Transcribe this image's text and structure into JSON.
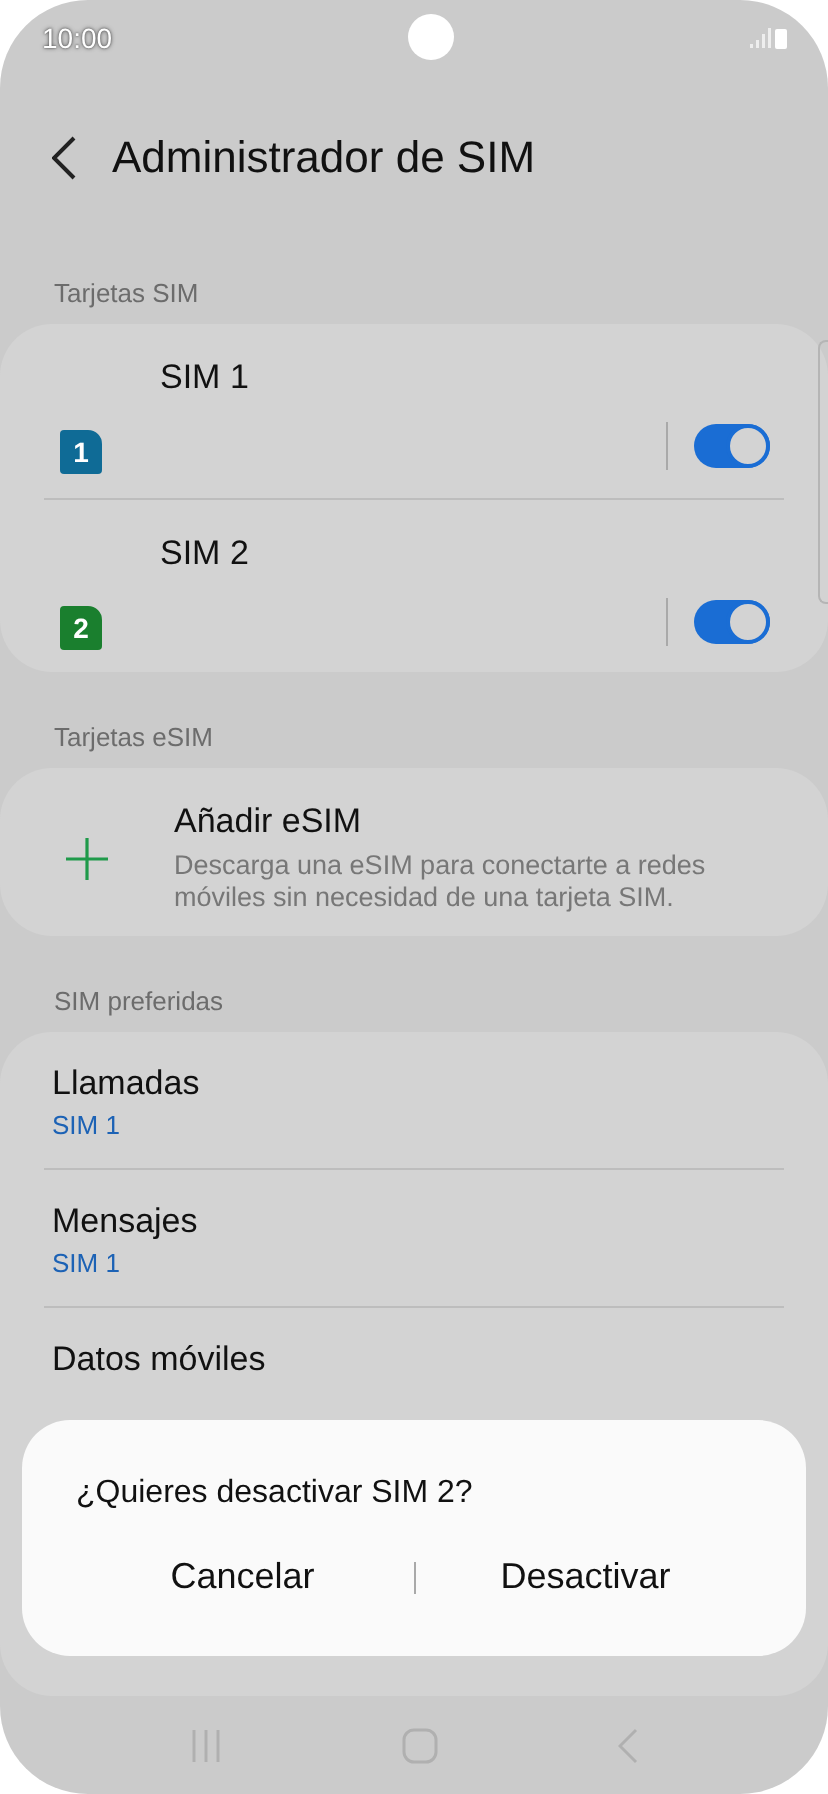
{
  "status_bar": {
    "time": "10:00"
  },
  "header": {
    "title": "Administrador de SIM"
  },
  "sections": [
    {
      "heading": "Tarjetas SIM",
      "items": [
        {
          "kind": "sim",
          "badge": "1",
          "color": "#0f6b96",
          "title": "SIM 1",
          "on": true
        },
        {
          "kind": "sim",
          "badge": "2",
          "color": "#1a7f2e",
          "title": "SIM 2",
          "on": true
        }
      ]
    },
    {
      "heading": "Tarjetas eSIM",
      "items": [
        {
          "kind": "add",
          "title": "Añadir eSIM",
          "subtitle": "Descarga una eSIM para conectarte a redes móviles sin necesidad de una tarjeta SIM."
        }
      ]
    },
    {
      "heading": "SIM preferidas",
      "items": [
        {
          "kind": "pref",
          "title": "Llamadas",
          "value": "SIM 1"
        },
        {
          "kind": "pref",
          "title": "Mensajes",
          "value": "SIM 1"
        },
        {
          "kind": "pref",
          "title": "Datos móviles"
        }
      ]
    }
  ],
  "dialog": {
    "message": "¿Quieres desactivar SIM 2?",
    "buttons": [
      "Cancelar",
      "Desactivar"
    ]
  }
}
